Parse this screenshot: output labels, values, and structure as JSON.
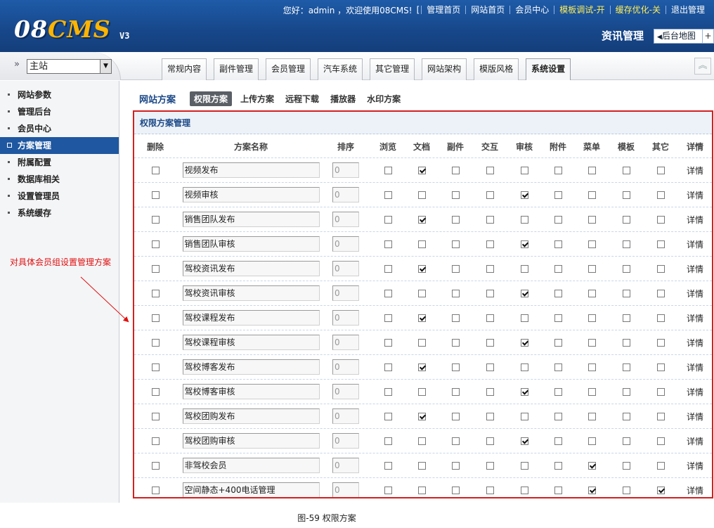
{
  "header": {
    "logo_main": "08",
    "logo_accent": "CMS",
    "version": "V3",
    "greeting": "您好：admin ，欢迎使用08CMS!",
    "links": [
      {
        "label": "管理首页",
        "highlight": false
      },
      {
        "label": "网站首页",
        "highlight": false
      },
      {
        "label": "会员中心",
        "highlight": false
      },
      {
        "label": "模板调试-开",
        "highlight": true
      },
      {
        "label": "缓存优化-关",
        "highlight": true
      },
      {
        "label": "退出管理",
        "highlight": false
      }
    ],
    "section_title": "资讯管理",
    "sitemap_label": "后台地图",
    "colors": {
      "bar": "#17478a",
      "highlight": "#ffee55"
    }
  },
  "nav": {
    "site_select": "主站",
    "tabs": [
      {
        "label": "常规内容",
        "active": false
      },
      {
        "label": "副件管理",
        "active": false
      },
      {
        "label": "会员管理",
        "active": false
      },
      {
        "label": "汽车系统",
        "active": false
      },
      {
        "label": "其它管理",
        "active": false
      },
      {
        "label": "网站架构",
        "active": false
      },
      {
        "label": "模版风格",
        "active": false
      },
      {
        "label": "系统设置",
        "active": true
      }
    ]
  },
  "sidebar": {
    "items": [
      {
        "label": "网站参数",
        "active": false
      },
      {
        "label": "管理后台",
        "active": false
      },
      {
        "label": "会员中心",
        "active": false
      },
      {
        "label": "方案管理",
        "active": true
      },
      {
        "label": "附属配置",
        "active": false
      },
      {
        "label": "数据库相关",
        "active": false
      },
      {
        "label": "设置管理员",
        "active": false
      },
      {
        "label": "系统缓存",
        "active": false
      }
    ],
    "active_color": "#1f57a0"
  },
  "annotation": "对具体会员组设置管理方案",
  "subtabs": {
    "title": "网站方案",
    "items": [
      {
        "label": "权限方案",
        "active": true
      },
      {
        "label": "上传方案",
        "active": false
      },
      {
        "label": "远程下载",
        "active": false
      },
      {
        "label": "播放器",
        "active": false
      },
      {
        "label": "水印方案",
        "active": false
      }
    ]
  },
  "panel": {
    "title": "权限方案管理",
    "columns": [
      "删除",
      "方案名称",
      "排序",
      "浏览",
      "文档",
      "副件",
      "交互",
      "审核",
      "附件",
      "菜单",
      "模板",
      "其它",
      "详情"
    ],
    "rows": [
      {
        "name": "视频发布",
        "order": "0",
        "perms": [
          false,
          true,
          false,
          false,
          false,
          false,
          false,
          false,
          false
        ],
        "detail": "详情"
      },
      {
        "name": "视频审核",
        "order": "0",
        "perms": [
          false,
          false,
          false,
          false,
          true,
          false,
          false,
          false,
          false
        ],
        "detail": "详情"
      },
      {
        "name": "销售团队发布",
        "order": "0",
        "perms": [
          false,
          true,
          false,
          false,
          false,
          false,
          false,
          false,
          false
        ],
        "detail": "详情"
      },
      {
        "name": "销售团队审核",
        "order": "0",
        "perms": [
          false,
          false,
          false,
          false,
          true,
          false,
          false,
          false,
          false
        ],
        "detail": "详情"
      },
      {
        "name": "驾校资讯发布",
        "order": "0",
        "perms": [
          false,
          true,
          false,
          false,
          false,
          false,
          false,
          false,
          false
        ],
        "detail": "详情"
      },
      {
        "name": "驾校资讯审核",
        "order": "0",
        "perms": [
          false,
          false,
          false,
          false,
          true,
          false,
          false,
          false,
          false
        ],
        "detail": "详情"
      },
      {
        "name": "驾校课程发布",
        "order": "0",
        "perms": [
          false,
          true,
          false,
          false,
          false,
          false,
          false,
          false,
          false
        ],
        "detail": "详情"
      },
      {
        "name": "驾校课程审核",
        "order": "0",
        "perms": [
          false,
          false,
          false,
          false,
          true,
          false,
          false,
          false,
          false
        ],
        "detail": "详情"
      },
      {
        "name": "驾校博客发布",
        "order": "0",
        "perms": [
          false,
          true,
          false,
          false,
          false,
          false,
          false,
          false,
          false
        ],
        "detail": "详情"
      },
      {
        "name": "驾校博客审核",
        "order": "0",
        "perms": [
          false,
          false,
          false,
          false,
          true,
          false,
          false,
          false,
          false
        ],
        "detail": "详情"
      },
      {
        "name": "驾校团购发布",
        "order": "0",
        "perms": [
          false,
          true,
          false,
          false,
          false,
          false,
          false,
          false,
          false
        ],
        "detail": "详情"
      },
      {
        "name": "驾校团购审核",
        "order": "0",
        "perms": [
          false,
          false,
          false,
          false,
          true,
          false,
          false,
          false,
          false
        ],
        "detail": "详情"
      },
      {
        "name": "非驾校会员",
        "order": "0",
        "perms": [
          false,
          false,
          false,
          false,
          false,
          false,
          true,
          false,
          false
        ],
        "detail": "详情"
      },
      {
        "name": "空间静态+400电话管理",
        "order": "0",
        "perms": [
          false,
          false,
          false,
          false,
          false,
          false,
          true,
          false,
          true
        ],
        "detail": "详情"
      }
    ],
    "border_color": "#d32020"
  },
  "caption": "图-59 权限方案"
}
